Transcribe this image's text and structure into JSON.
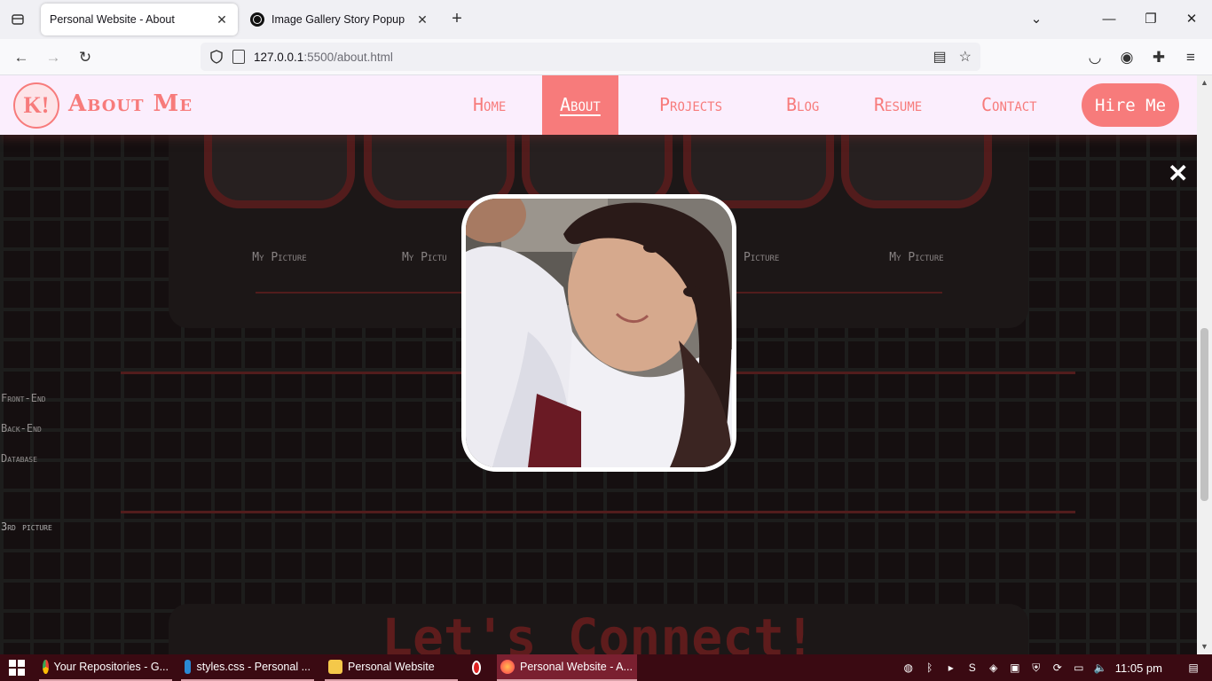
{
  "browser": {
    "tabs": [
      {
        "title": "Personal Website - About",
        "active": true
      },
      {
        "title": "Image Gallery Story Popup",
        "active": false
      }
    ],
    "url": {
      "host": "127.0.0.1",
      "path": ":5500/about.html"
    }
  },
  "site": {
    "logo_text": "K!",
    "brand": "About Me",
    "nav": [
      "Home",
      "About",
      "Projects",
      "Blog",
      "Resume",
      "Contact"
    ],
    "active_nav": "About",
    "hire_label": "Hire Me"
  },
  "gallery": {
    "captions": [
      "My Picture",
      "My Pictu",
      "Picture",
      "My Picture"
    ]
  },
  "skills": [
    "Front-End",
    "Back-End",
    "Database"
  ],
  "third_picture_label": "3rd picture",
  "connect_heading": "Let's Connect!",
  "popup": {
    "close_symbol": "✕"
  },
  "taskbar": {
    "items": [
      {
        "label": "Your Repositories - G...",
        "icon": "chrome-icon"
      },
      {
        "label": "styles.css - Personal ...",
        "icon": "vscode-icon"
      },
      {
        "label": "Personal Website",
        "icon": "folder-icon"
      },
      {
        "label": "Personal Website - A...",
        "icon": "firefox-icon"
      }
    ],
    "time": "11:05 pm"
  },
  "colors": {
    "accent": "#f77b7b",
    "header_bg": "#fbeefd",
    "taskbar_bg": "#3a0a12"
  }
}
